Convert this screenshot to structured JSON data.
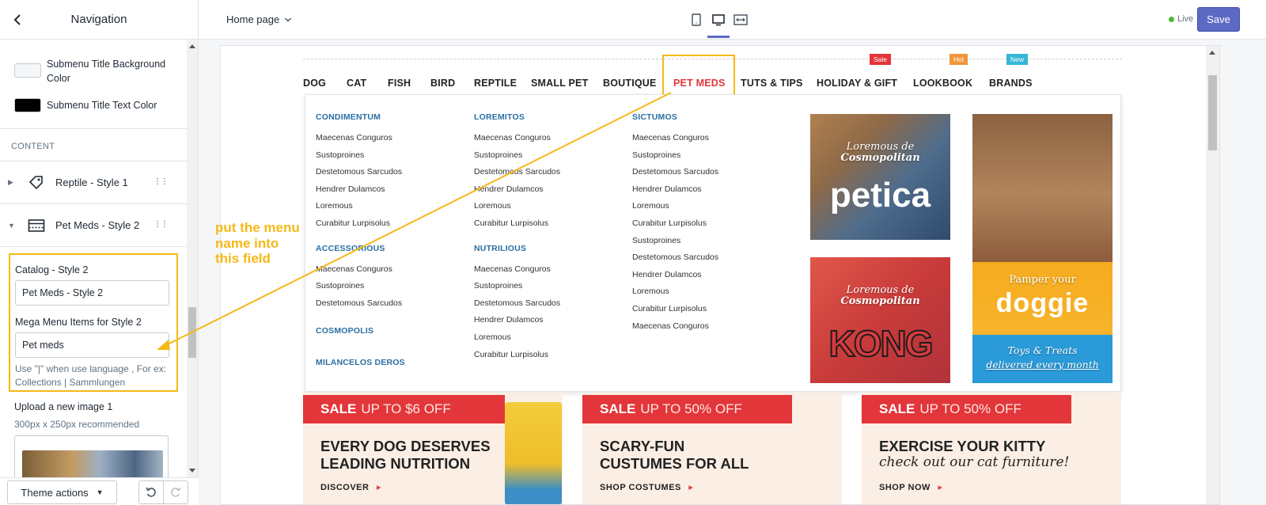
{
  "sidebar": {
    "title": "Navigation",
    "colors": [
      {
        "label": "Submenu Title Background Color",
        "swatch": "#f4f6f8"
      },
      {
        "label": "Submenu Title Text Color",
        "swatch": "#000000"
      }
    ],
    "section_label": "CONTENT",
    "items": [
      {
        "label": "Reptile - Style 1",
        "icon": "tag-icon",
        "caret": "▶"
      },
      {
        "label": "Pet Meds - Style 2",
        "icon": "mega-menu-icon",
        "caret": "▼"
      }
    ],
    "catalog": {
      "label": "Catalog - Style 2",
      "value": "Pet Meds - Style 2",
      "mega_label": "Mega Menu Items for Style 2",
      "mega_value": "Pet meds",
      "help": "Use \"|\" when use language , For ex: Collections | Sammlungen"
    },
    "upload": {
      "label": "Upload a new image 1",
      "note": "300px x 250px recommended"
    },
    "footer": {
      "theme_actions": "Theme actions"
    }
  },
  "topbar": {
    "page_select": "Home page",
    "live": "Live",
    "save": "Save"
  },
  "annotation": {
    "text": "put the menu name into this field",
    "color": "#f5b916"
  },
  "store": {
    "nav": [
      "DOG",
      "CAT",
      "FISH",
      "BIRD",
      "REPTILE",
      "SMALL PET",
      "BOUTIQUE",
      "PET MEDS",
      "TUTS & TIPS",
      "HOLIDAY & GIFT",
      "LOOKBOOK",
      "BRANDS"
    ],
    "badges": [
      {
        "text": "Sale",
        "color": "#e2363a"
      },
      {
        "text": "Hot",
        "color": "#f0963a"
      },
      {
        "text": "New",
        "color": "#37b6d6"
      }
    ],
    "mega": {
      "col1": {
        "groups": [
          {
            "head": "CONDIMENTUM",
            "links": [
              "Maecenas Conguros",
              "Sustoproines",
              "Destetomous Sarcudos",
              "Hendrer Dulamcos",
              "Loremous",
              "Curabitur Lurpisolus"
            ]
          },
          {
            "head": "ACCESSORIOUS",
            "links": [
              "Maecenas Conguros",
              "Sustoproines",
              "Destetomous Sarcudos"
            ]
          },
          {
            "head": "COSMOPOLIS",
            "links": []
          },
          {
            "head": "MILANCELOS DEROS",
            "links": []
          }
        ]
      },
      "col2": {
        "groups": [
          {
            "head": "LOREMITOS",
            "links": [
              "Maecenas Conguros",
              "Sustoproines",
              "Destetomous Sarcudos",
              "Hendrer Dulamcos",
              "Loremous",
              "Curabitur Lurpisolus"
            ]
          },
          {
            "head": "NUTRILIOUS",
            "links": [
              "Maecenas Conguros",
              "Sustoproines",
              "Destetomous Sarcudos",
              "Hendrer Dulamcos",
              "Loremous",
              "Curabitur Lurpisolus"
            ]
          }
        ]
      },
      "col3": {
        "groups": [
          {
            "head": "SICTUMOS",
            "links": [
              "Maecenas Conguros",
              "Sustoproines",
              "Destetomous Sarcudos",
              "Hendrer Dulamcos",
              "Loremous",
              "Curabitur Lurpisolus",
              "Sustoproines",
              "Destetomous Sarcudos",
              "Hendrer Dulamcos",
              "Loremous",
              "Curabitur Lurpisolus",
              "Maecenas Conguros"
            ]
          }
        ]
      },
      "promos": [
        {
          "line1": "Loremous de",
          "line2": "Cosmopolitan",
          "brand": "petica"
        },
        {
          "line1": "Loremous de",
          "line2": "Cosmopolitan",
          "brand": "KONG"
        },
        {
          "line1": "Pamper your",
          "brand": "doggie",
          "line2": "Toys & Treats",
          "line3": "delivered every month"
        }
      ]
    },
    "banners": [
      {
        "sale": "SALE",
        "offer": "UP TO $6 OFF",
        "head1": "EVERY DOG DESERVES",
        "head2": "LEADING NUTRITION",
        "cta": "DISCOVER"
      },
      {
        "sale": "SALE",
        "offer": "UP TO 50% OFF",
        "head1": "SCARY-FUN",
        "head2": "CUSTUMES FOR ALL",
        "cta": "SHOP COSTUMES"
      },
      {
        "sale": "SALE",
        "offer": "UP TO 50% OFF",
        "head1": "EXERCISE YOUR KITTY",
        "script": "check out our cat furniture!",
        "cta": "SHOP NOW"
      }
    ]
  }
}
